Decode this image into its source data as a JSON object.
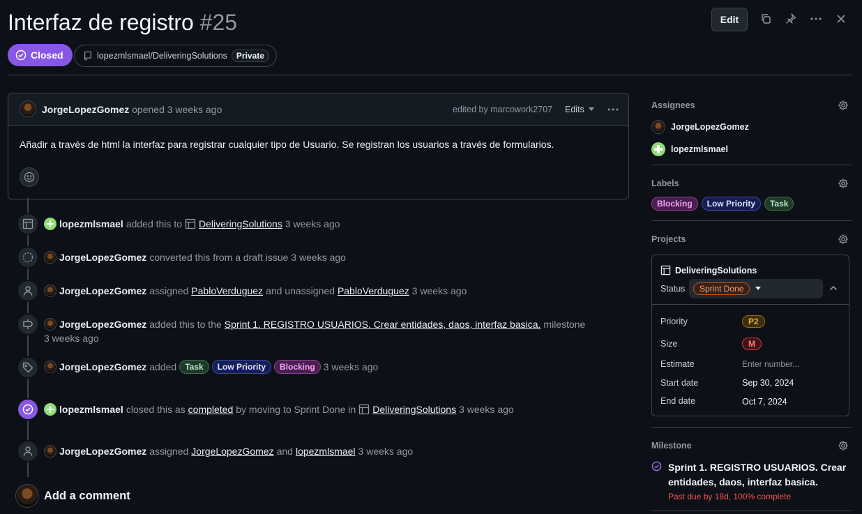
{
  "header": {
    "title": "Interfaz de registro",
    "number": "#25",
    "edit_label": "Edit",
    "status": "Closed",
    "repo": "lopezmlsmael/DeliveringSolutions",
    "visibility": "Private"
  },
  "issue": {
    "author": "JorgeLopezGomez",
    "opened": "opened 3 weeks ago",
    "edited_by": "edited by marcowork2707",
    "edits_label": "Edits",
    "body": "Añadir a través de html la interfaz para registrar cualquier tipo de Usuario. Se registran los usuarios a través de formularios."
  },
  "timeline": {
    "e1": {
      "actor": "lopezmlsmael",
      "text1": "added this to",
      "link": "DeliveringSolutions",
      "time": "3 weeks ago"
    },
    "e2": {
      "actor": "JorgeLopezGomez",
      "text1": "converted this from a draft issue 3 weeks ago"
    },
    "e3": {
      "actor": "JorgeLopezGomez",
      "text1": "assigned",
      "link1": "PabloVerduguez",
      "text2": "and unassigned",
      "link2": "PabloVerduguez",
      "time": "3 weeks ago"
    },
    "e4": {
      "actor": "JorgeLopezGomez",
      "text1": "added this to the",
      "link": "Sprint 1. REGISTRO USUARIOS. Crear entidades, daos, interfaz basica.",
      "text2": "milestone",
      "time": "3 weeks ago"
    },
    "e5": {
      "actor": "JorgeLopezGomez",
      "text1": "added",
      "time": "3 weeks ago"
    },
    "e6": {
      "actor": "lopezmlsmael",
      "text1": "closed this as",
      "link1": "completed",
      "text2": "by moving to Sprint Done in",
      "link2": "DeliveringSolutions",
      "time": "3 weeks ago"
    },
    "e7": {
      "actor": "JorgeLopezGomez",
      "text1": "assigned",
      "link1": "JorgeLopezGomez",
      "text2": "and",
      "link2": "lopezmlsmael",
      "time": "3 weeks ago"
    }
  },
  "labels": {
    "task": "Task",
    "low": "Low Priority",
    "blocking": "Blocking"
  },
  "add_comment": "Add a comment",
  "sidebar": {
    "assignees_title": "Assignees",
    "assignee1": "JorgeLopezGomez",
    "assignee2": "lopezmlsmael",
    "labels_title": "Labels",
    "projects_title": "Projects",
    "project_name": "DeliveringSolutions",
    "status_label": "Status",
    "status_value": "Sprint Done",
    "priority_label": "Priority",
    "priority_value": "P2",
    "size_label": "Size",
    "size_value": "M",
    "estimate_label": "Estimate",
    "estimate_placeholder": "Enter number...",
    "start_label": "Start date",
    "start_value": "Sep 30, 2024",
    "end_label": "End date",
    "end_value": "Oct 7, 2024",
    "milestone_title": "Milestone",
    "milestone_name": "Sprint 1. REGISTRO USUARIOS. Crear entidades, daos, interfaz basica.",
    "milestone_status": "Past due by 18d, 100% complete"
  },
  "colors": {
    "closed_purple": "#8957e5",
    "bg": "#0d1117",
    "past_due": "#f85149"
  }
}
